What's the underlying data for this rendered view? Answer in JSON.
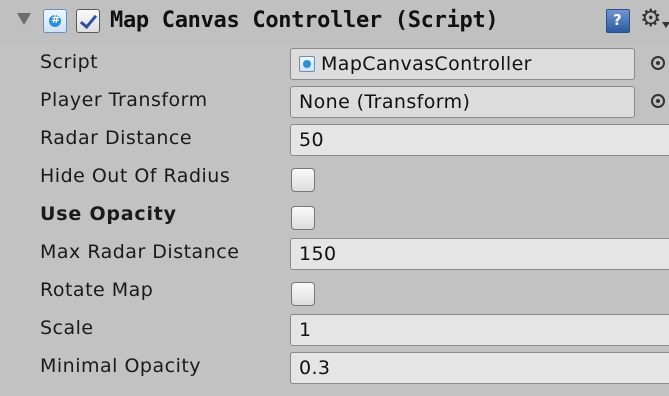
{
  "component": {
    "title": "Map Canvas Controller (Script)",
    "enabled": true,
    "icons": {
      "foldout": "foldout-arrow-icon",
      "script": "csharp-script-icon",
      "help": "help-book-icon",
      "settings": "gear-icon"
    }
  },
  "fields": {
    "script": {
      "label": "Script",
      "value": "MapCanvasController"
    },
    "player_transform": {
      "label": "Player Transform",
      "value": "None (Transform)"
    },
    "radar_distance": {
      "label": "Radar Distance",
      "value": "50"
    },
    "hide_out_of_radius": {
      "label": "Hide Out Of Radius",
      "checked": false
    },
    "use_opacity": {
      "label": "Use Opacity",
      "checked": false
    },
    "max_radar_distance": {
      "label": "Max Radar Distance",
      "value": "150"
    },
    "rotate_map": {
      "label": "Rotate Map",
      "checked": false
    },
    "scale": {
      "label": "Scale",
      "value": "1"
    },
    "minimal_opacity": {
      "label": "Minimal Opacity",
      "value": "0.3"
    }
  },
  "colors": {
    "panel_bg": "#c2c2c2",
    "field_bg": "#e5e5e5",
    "help_blue": "#2e5aa3",
    "script_blue": "#2b8fdc"
  }
}
